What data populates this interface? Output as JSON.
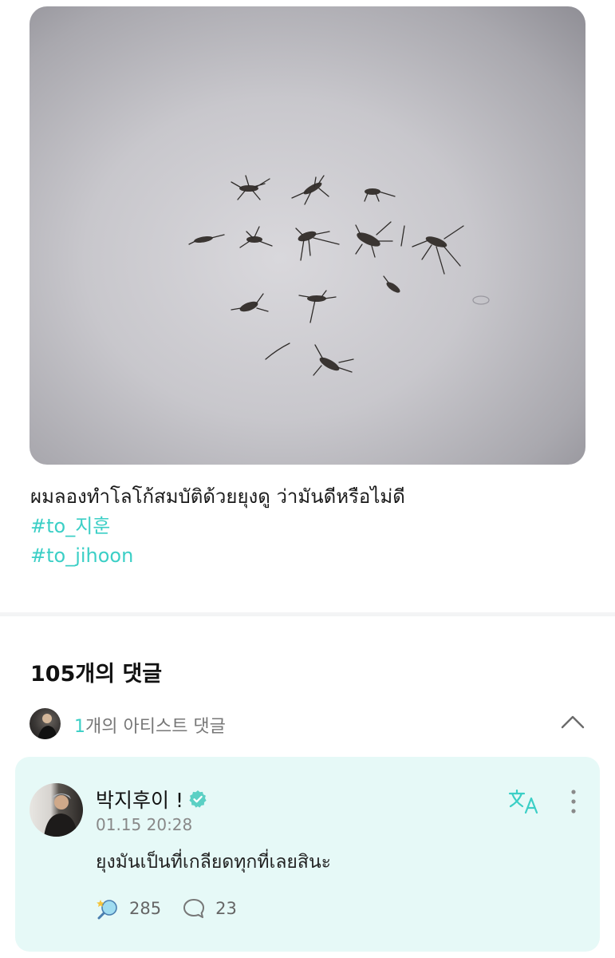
{
  "post": {
    "caption": "ผมลองทำโลโก้สมบัติด้วยยุงดู ว่ามันดีหรือไม่ดี",
    "hashtags": [
      "#to_지훈",
      "#to_jihoon"
    ]
  },
  "comments": {
    "count_label": "105개의 댓글",
    "artist_count": "1",
    "artist_label": "개의 아티스트 댓글"
  },
  "comment": {
    "author": "박지후이 !",
    "timestamp": "01.15 20:28",
    "text": "ยุงมันเป็นที่เกลียดทุกที่เลยสินะ",
    "likes": "285",
    "replies": "23"
  },
  "colors": {
    "accent": "#3bcfc6",
    "card_bg": "#e6f9f7"
  }
}
